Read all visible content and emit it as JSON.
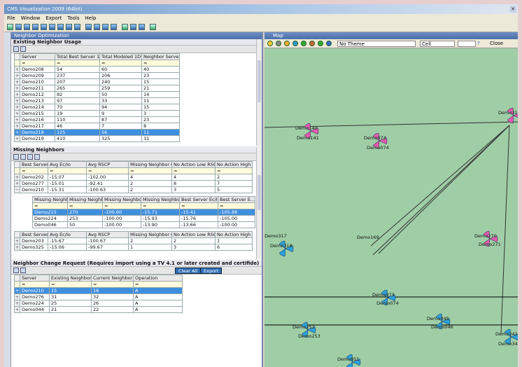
{
  "app": {
    "title": "CMS Visualization 2009 (64bit)"
  },
  "menu": [
    "File",
    "Window",
    "Export",
    "Tools",
    "Help"
  ],
  "left": {
    "title": "Neighbor Optimization",
    "usage": {
      "title": "Existing Neighbor Usage",
      "columns": [
        "Server",
        "Total Best Server 1D",
        "Total Modeled 1D",
        "Neighbor Server"
      ],
      "rows": [
        [
          "Demo208",
          "54",
          "60",
          "40"
        ],
        [
          "Demo209",
          "237",
          "206",
          "23"
        ],
        [
          "Demo210",
          "207",
          "240",
          "15"
        ],
        [
          "Demo211",
          "265",
          "259",
          "21"
        ],
        [
          "Demo212",
          "82",
          "50",
          "14"
        ],
        [
          "Demo213",
          "97",
          "33",
          "11"
        ],
        [
          "Demo214",
          "70",
          "94",
          "15"
        ],
        [
          "Demo215",
          "19",
          "9",
          "3"
        ],
        [
          "Demo216",
          "110",
          "87",
          "23"
        ],
        [
          "Demo217",
          "46",
          "7",
          "8"
        ],
        [
          "Demo218",
          "125",
          "56",
          "11"
        ],
        [
          "Demo219",
          "410",
          "325",
          "31"
        ]
      ]
    },
    "missing": {
      "title": "Missing Neighbors",
      "columns": [
        "Best Server",
        "Avg Ec/Io",
        "Avg RSCP",
        "Missing Neighbor Co",
        "No Action Low RSCP",
        "No Action High RSCP"
      ],
      "rows": [
        [
          "Demo202",
          "-15.07",
          "-102.00",
          "4",
          "4",
          "2"
        ],
        [
          "Demo277",
          "-15.01",
          "-92.41",
          "2",
          "8",
          "7"
        ],
        [
          "Demo210",
          "-15.31",
          "-100.63",
          "2",
          "3",
          "5"
        ]
      ],
      "sub_columns": [
        "Missing Neighbor",
        "Missing Neighbor",
        "Missing Neighbor",
        "Missing Neighbor",
        "Best Server Ec/Io",
        "Best Server E..."
      ],
      "sub_rows": [
        [
          "Demo215",
          "270",
          "-100.60",
          "-15.71",
          "-15.41",
          "-105.88"
        ],
        [
          "Demo224",
          "253",
          "-100.00",
          "-15.93",
          "-15.76",
          "-105.00"
        ],
        [
          "Demo046",
          "50",
          "-100.00",
          "-13.90",
          "-13.66",
          "-100.00"
        ]
      ],
      "bottom_rows": [
        [
          "Demo203",
          "-15.67",
          "-100.67",
          "2",
          "2",
          "1"
        ],
        [
          "Demo325",
          "-15.06",
          "-99.67",
          "1",
          "3",
          "6"
        ]
      ]
    },
    "change": {
      "title": "Neighbor Change Request (Requires import using a TV 4.1 or later created and certifide)",
      "clear_label": "Clear All",
      "export_label": "Export",
      "columns": [
        "Server",
        "Existing Neighbor",
        "Current Neighbor",
        "Operation"
      ],
      "rows": [
        [
          "Demo210",
          "15",
          "16",
          "A"
        ],
        [
          "Demo276",
          "31",
          "32",
          "A"
        ],
        [
          "Demo224",
          "25",
          "26",
          "A"
        ],
        [
          "Demo044",
          "21",
          "22",
          "A"
        ]
      ]
    }
  },
  "right": {
    "title": "Map",
    "select1": "No Theme",
    "select2": "Cell",
    "close_label": "Close",
    "sites": [
      {
        "label": "Demo140"
      },
      {
        "label": "Demo141"
      },
      {
        "label": "Demo073"
      },
      {
        "label": "Demo074"
      },
      {
        "label": "Demo318"
      },
      {
        "label": "Demo317"
      },
      {
        "label": "Demo318"
      },
      {
        "label": "Demo169"
      },
      {
        "label": "Demo270"
      },
      {
        "label": "Demo271"
      },
      {
        "label": "Demo073"
      },
      {
        "label": "Demo074"
      },
      {
        "label": "Demo252"
      },
      {
        "label": "Demo253"
      },
      {
        "label": "Demo045"
      },
      {
        "label": "Demo046"
      },
      {
        "label": "Demo341"
      },
      {
        "label": "Demo343"
      },
      {
        "label": "Demo051"
      }
    ]
  }
}
